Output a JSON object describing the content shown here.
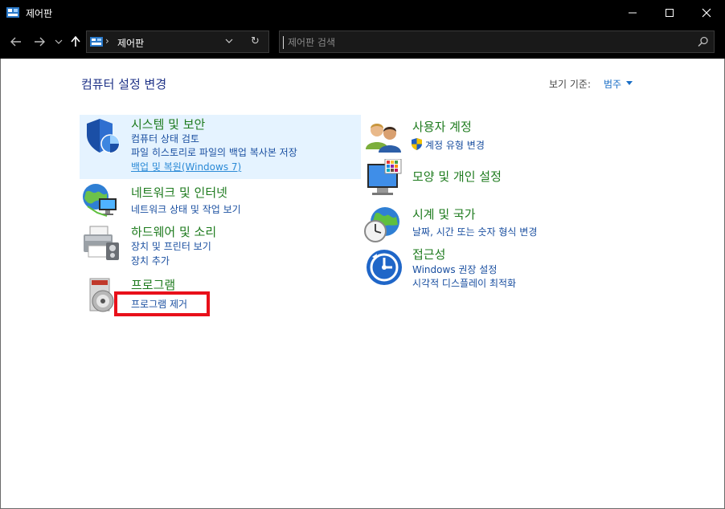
{
  "window": {
    "title": "제어판"
  },
  "address": {
    "path": "제어판"
  },
  "search": {
    "placeholder": "제어판 검색"
  },
  "heading": "컴퓨터 설정 변경",
  "viewby": {
    "label": "보기 기준:",
    "value": "범주"
  },
  "left": {
    "system": {
      "title": "시스템 및 보안",
      "links": [
        "컴퓨터 상태 검토",
        "파일 히스토리로 파일의 백업 복사본 저장",
        "백업 및 복원(Windows 7)"
      ]
    },
    "network": {
      "title": "네트워크 및 인터넷",
      "links": [
        "네트워크 상태 및 작업 보기"
      ]
    },
    "hardware": {
      "title": "하드웨어 및 소리",
      "links": [
        "장치 및 프린터 보기",
        "장치 추가"
      ]
    },
    "programs": {
      "title": "프로그램",
      "links": [
        "프로그램 제거"
      ]
    }
  },
  "right": {
    "users": {
      "title": "사용자 계정",
      "links": [
        "계정 유형 변경"
      ]
    },
    "appearance": {
      "title": "모양 및 개인 설정",
      "links": []
    },
    "clock": {
      "title": "시계 및 국가",
      "links": [
        "날짜, 시간 또는 숫자 형식 변경"
      ]
    },
    "access": {
      "title": "접근성",
      "links": [
        "Windows 권장 설정",
        "시각적 디스플레이 최적화"
      ]
    }
  },
  "colors": {
    "title_green": "#1e7b1e",
    "link_blue": "#1a4fa0",
    "highlight": "#e8101a",
    "hover": "#e5f3ff"
  }
}
